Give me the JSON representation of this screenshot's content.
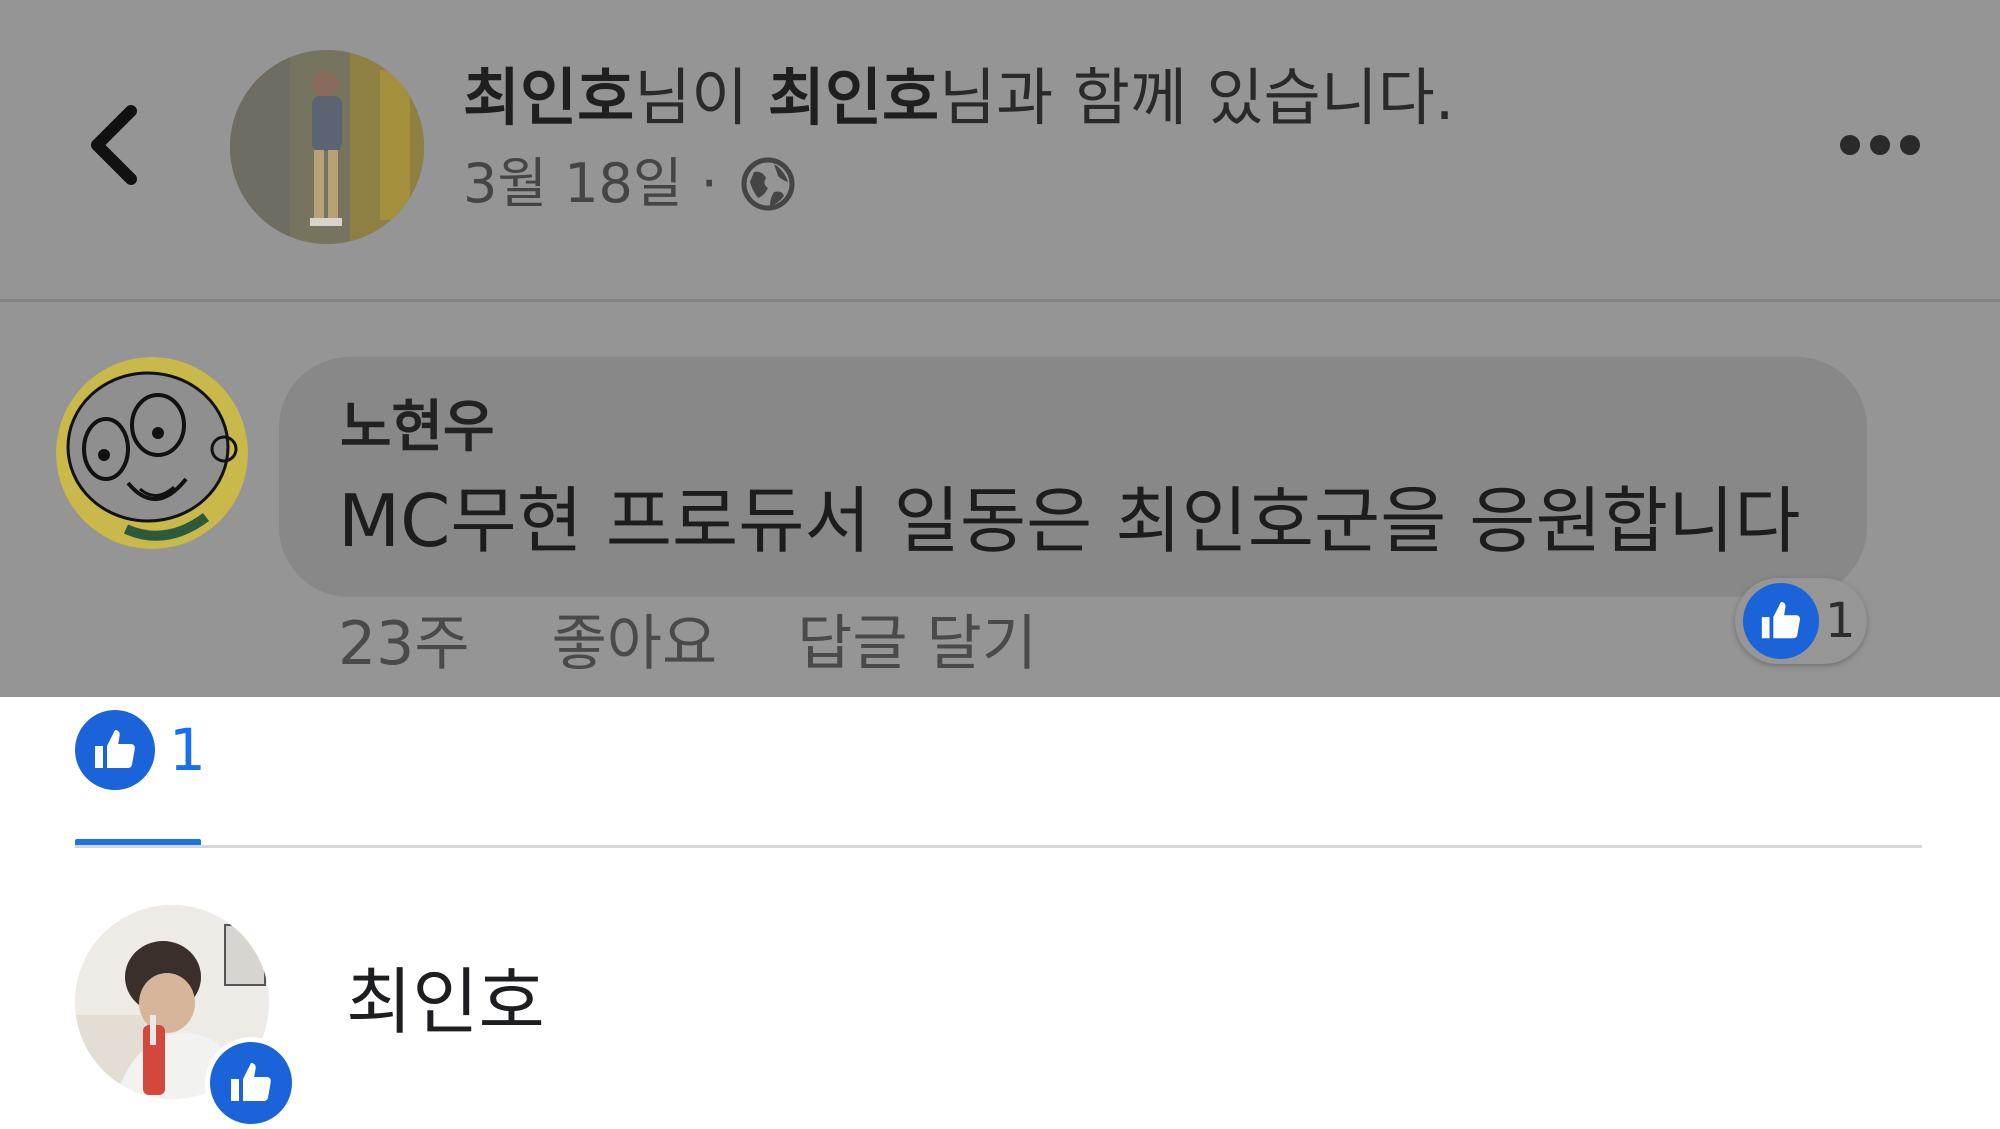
{
  "post_header": {
    "author_name": "최인호",
    "author_suffix": "님이 ",
    "tagged_name": "최인호",
    "tagged_suffix": "님과 함께 있습니다.",
    "date": "3월 18일",
    "separator": "·",
    "privacy_icon": "globe-icon",
    "back_icon": "chevron-left-icon",
    "more_icon": "more-dots-icon"
  },
  "comment": {
    "author": "노현우",
    "text": "MC무현 프로듀서 일동은 최인호군을 응원합니다",
    "time": "23주",
    "like_action": "좋아요",
    "reply_action": "답글 달기",
    "reaction_count": "1",
    "reaction_icon": "like-icon"
  },
  "reactions_panel": {
    "tabs": [
      {
        "icon": "like-icon",
        "count": "1",
        "active": true
      }
    ],
    "reactors": [
      {
        "name": "최인호",
        "reaction": "like-icon"
      }
    ]
  },
  "colors": {
    "facebook_blue": "#1b74e4",
    "like_blue": "#1b63d8",
    "dim_overlay": "#959595",
    "bubble": "#888888"
  }
}
